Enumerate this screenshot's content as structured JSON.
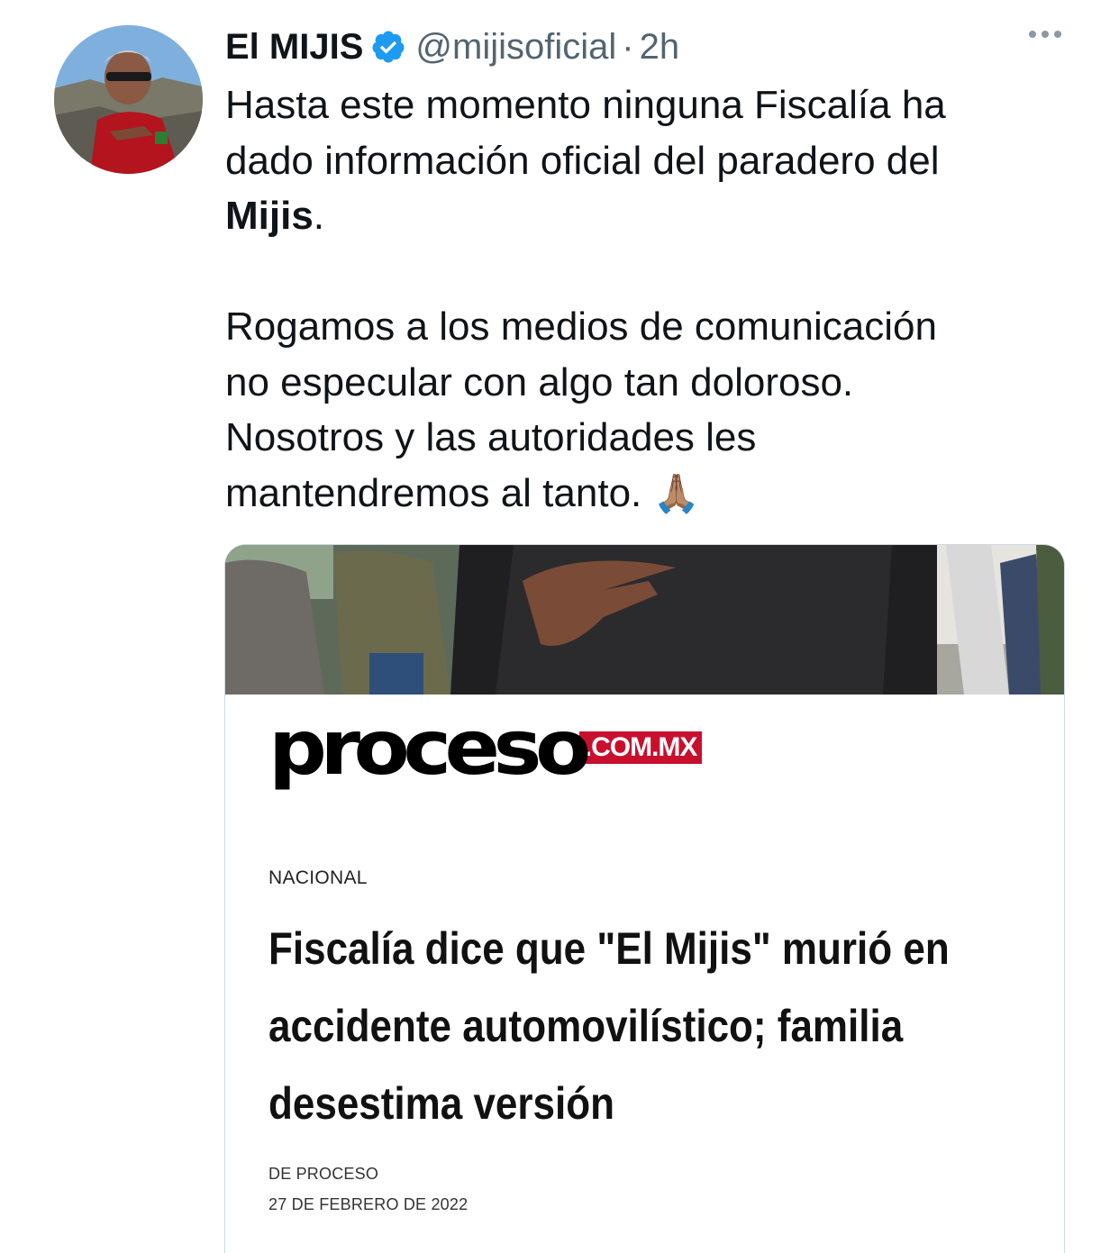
{
  "author": {
    "name": "El MIJIS",
    "handle": "@mijisoficial",
    "separator": "·",
    "time": "2h"
  },
  "tweet": {
    "line1": "Hasta este momento ninguna Fiscalía ha",
    "line2": "dado información oficial del paradero del",
    "line3_bold": "Mijis",
    "line3_rest": ".",
    "para2_line1": "Rogamos a los medios de comunicación",
    "para2_line2": "no especular con algo tan doloroso.",
    "para2_line3": "Nosotros y las autoridades les",
    "para2_line4": "mantendremos al tanto.",
    "emoji": "🙏🏽"
  },
  "card": {
    "logo_main": "proceso",
    "logo_domain": ".COM.MX",
    "section": "NACIONAL",
    "headline_line1": "Fiscalía dice que \"El Mijis\" murió en",
    "headline_line2": "accidente automovilístico; familia",
    "headline_line3": "desestima versión",
    "source": "DE PROCESO",
    "date": "27 DE FEBRERO DE 2022"
  },
  "colors": {
    "verified": "#1d9bf0",
    "secondary_text": "#536471",
    "brand_red": "#c8102e"
  },
  "icons": {
    "verified": "verified-badge-icon",
    "more": "more-options-icon"
  }
}
